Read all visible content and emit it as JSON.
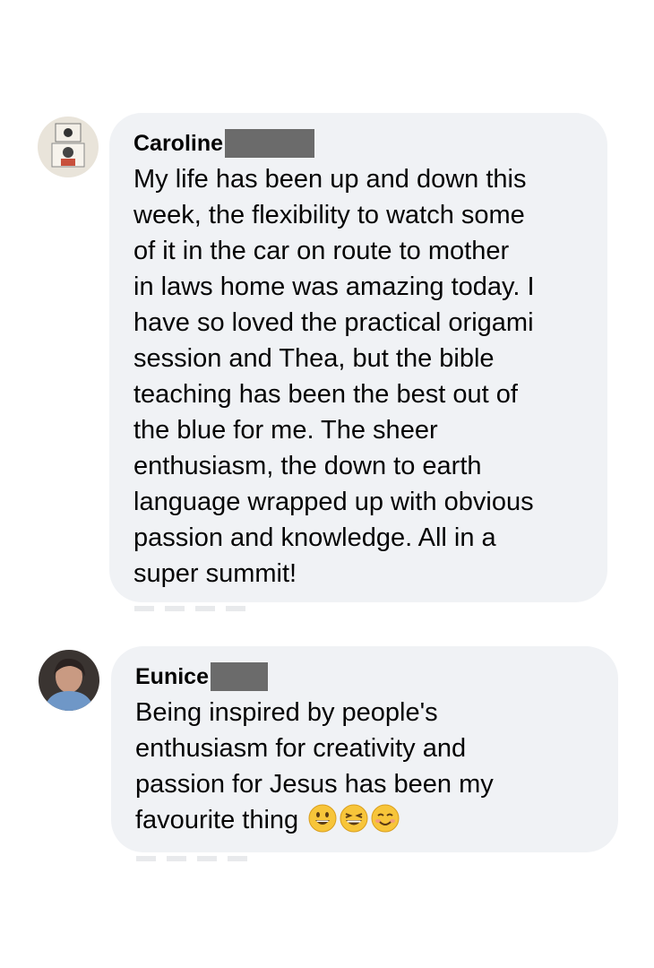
{
  "comments": [
    {
      "name": "Caroline",
      "text_lines": [
        "My life has been up and down this",
        "week, the flexibility to watch some",
        "of it in the car on route to mother",
        "in laws home was amazing today. I",
        "have so loved the practical origami",
        "session and Thea, but the bible",
        "teaching has been the best out of",
        "the blue for me. The sheer",
        "enthusiasm, the down to earth",
        "language wrapped up with obvious",
        "passion and knowledge. All in a",
        "super summit!"
      ]
    },
    {
      "name": "Eunice",
      "text_lines": [
        "Being inspired by people's",
        "enthusiasm for creativity and",
        "passion for Jesus has been my",
        "favourite thing"
      ],
      "emojis": [
        "grinning-face-icon",
        "grinning-squinting-face-icon",
        "smiling-face-icon"
      ]
    }
  ],
  "colors": {
    "bubble": "#f0f2f5",
    "redaction": "#6b6b6b"
  }
}
